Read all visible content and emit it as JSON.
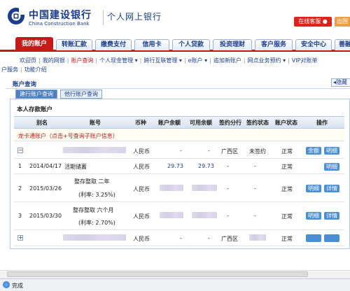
{
  "header": {
    "bank_name_cn": "中国建设银行",
    "bank_name_en": "China Construction Bank",
    "title": "个人网上银行",
    "service_button": "在线客服 ●",
    "exit_button": "出国"
  },
  "nav": {
    "tabs": [
      "我的账户",
      "转账汇款",
      "缴费支付",
      "信用卡",
      "个人贷款",
      "投资理财",
      "客户服务",
      "安全中心",
      "善融"
    ]
  },
  "submenu": {
    "row1": [
      "欢迎页",
      "我的网银",
      "账户查询",
      "个人现金管理 ▾",
      "跨行互联管理 ▾",
      "e账户 ▾",
      "追加新账户",
      "网点业务预约 ▾",
      "VIP对账单"
    ],
    "row2": [
      "户服务",
      "功能介绍"
    ],
    "current": "账户查询"
  },
  "section": {
    "title": "账户查询",
    "hide_label": "◂隐藏",
    "subtabs": [
      "建行账户查询",
      "他行账户查询"
    ]
  },
  "table": {
    "panel_title": "本人存款账户",
    "headers": [
      "别名",
      "账号",
      "币种",
      "账户余额",
      "可用余额",
      "签约分行",
      "签约状态",
      "账户状态",
      "操作"
    ],
    "notice": "龙卡通账户（点击+号查询子账户信息）",
    "rows": [
      {
        "expander": "−",
        "currency": "人民币",
        "balance": "-",
        "available": "-",
        "branch": "广西区",
        "sign_status": "未签约",
        "status": "正常",
        "actions": [
          "余额",
          "明细"
        ]
      },
      {
        "index": "1",
        "date": "2014/04/17",
        "account": "活期储蓄",
        "currency": "人民币",
        "balance": "29.73",
        "available": "29.73",
        "branch": "-",
        "sign_status": "-",
        "status": "正常",
        "actions": [
          "明细"
        ]
      },
      {
        "index": "2",
        "date": "2015/03/26",
        "account": "整存整取 二年",
        "rate": "(利率: 3.25%)",
        "currency": "人民币",
        "balance": "",
        "available": "-",
        "branch": "-",
        "sign_status": "-",
        "status": "正常",
        "actions": [
          "明细",
          "详情"
        ]
      },
      {
        "index": "3",
        "date": "2015/03/30",
        "account": "整存整取 六个月",
        "rate": "(利率: 2.70%)",
        "currency": "人民币",
        "balance": "",
        "available": "-",
        "branch": "-",
        "sign_status": "-",
        "status": "正常",
        "actions": [
          "明细",
          "详情"
        ]
      },
      {
        "expander": "+",
        "currency": "人民币",
        "balance": "-",
        "available": "-",
        "branch": "广西区",
        "sign_status": "",
        "status": "正常",
        "actions": []
      }
    ]
  },
  "statusbar": {
    "text": "完成"
  },
  "colors": {
    "brand_blue": "#1a3d8f",
    "accent_red": "#c41a1a",
    "button_blue": "#4a8ed6"
  }
}
